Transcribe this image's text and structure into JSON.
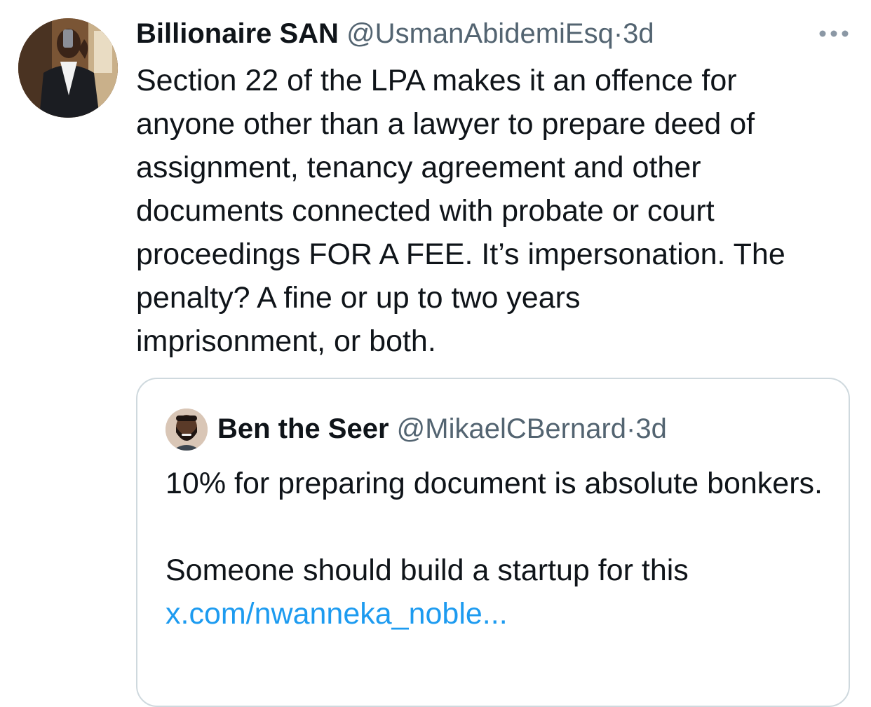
{
  "tweet": {
    "display_name": "Billionaire SAN",
    "handle": "@UsmanAbidemiEsq",
    "separator": "·",
    "time": "3d",
    "more_icon": "ellipsis-icon",
    "text": "Section 22 of the LPA makes it an offence for\nanyone other than a lawyer to prepare deed of\nassignment, tenancy agreement and other\ndocuments connected with probate or court\nproceedings FOR A FEE. It’s impersonation. The\npenalty? A fine or up to two years\nimprisonment, or both."
  },
  "quoted_tweet": {
    "display_name": "Ben the Seer",
    "handle": "@MikaelCBernard",
    "separator": "·",
    "time": "3d",
    "text_line_1": "10% for preparing document is absolute bonkers.",
    "text_line_2": "Someone should build a startup for this",
    "link": "x.com/nwanneka_noble..."
  },
  "colors": {
    "text": "#0f1419",
    "secondary": "#536471",
    "link": "#1d9bf0",
    "border": "#cfd9de"
  }
}
